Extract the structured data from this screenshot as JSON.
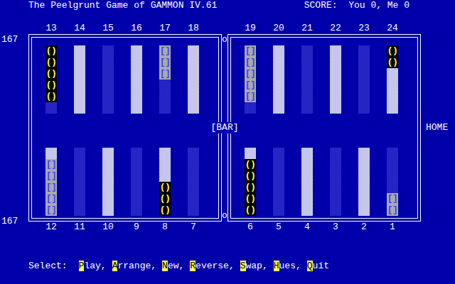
{
  "title": "The Peelgrunt Game of GAMMON IV.61",
  "score": "SCORE:  You 0, Me 0",
  "pip_counts": [
    "167",
    "167"
  ],
  "bar": {
    "label": "[BAR]",
    "marks": [
      "o",
      "o"
    ]
  },
  "home": "HOME",
  "board": {
    "top_left": [
      {
        "label": "13",
        "shade": "dark",
        "checkers": [
          {
            "glyph": "()",
            "kind": "round",
            "color": "#ffff55"
          },
          {
            "glyph": "()",
            "kind": "round",
            "color": "#ffff55"
          },
          {
            "glyph": "()",
            "kind": "round",
            "color": "#ffff55"
          },
          {
            "glyph": "()",
            "kind": "round",
            "color": "#ffff55"
          },
          {
            "glyph": "()",
            "kind": "round",
            "color": "#ffff55"
          }
        ]
      },
      {
        "label": "14",
        "shade": "light",
        "checkers": []
      },
      {
        "label": "15",
        "shade": "dark",
        "checkers": []
      },
      {
        "label": "16",
        "shade": "light",
        "checkers": []
      },
      {
        "label": "17",
        "shade": "dark",
        "checkers": [
          {
            "glyph": "[]",
            "kind": "square",
            "color": "#aaaaaa"
          },
          {
            "glyph": "[]",
            "kind": "square",
            "color": "#aaaaaa"
          },
          {
            "glyph": "[]",
            "kind": "square",
            "color": "#aaaaaa"
          }
        ]
      },
      {
        "label": "18",
        "shade": "light",
        "checkers": []
      }
    ],
    "top_right": [
      {
        "label": "19",
        "shade": "dark",
        "checkers": [
          {
            "glyph": "[]",
            "kind": "square",
            "color": "#aaaaaa"
          },
          {
            "glyph": "[]",
            "kind": "square",
            "color": "#aaaaaa"
          },
          {
            "glyph": "[]",
            "kind": "square",
            "color": "#aaaaaa"
          },
          {
            "glyph": "[]",
            "kind": "square",
            "color": "#aaaaaa"
          },
          {
            "glyph": "[]",
            "kind": "square",
            "color": "#aaaaaa"
          }
        ]
      },
      {
        "label": "20",
        "shade": "light",
        "checkers": []
      },
      {
        "label": "21",
        "shade": "dark",
        "checkers": []
      },
      {
        "label": "22",
        "shade": "light",
        "checkers": []
      },
      {
        "label": "23",
        "shade": "dark",
        "checkers": []
      },
      {
        "label": "24",
        "shade": "light",
        "checkers": [
          {
            "glyph": "()",
            "kind": "round",
            "color": "#ffff55"
          },
          {
            "glyph": "()",
            "kind": "round",
            "color": "#ffff55"
          }
        ]
      }
    ],
    "bottom_left": [
      {
        "label": "12",
        "shade": "light",
        "checkers": [
          {
            "glyph": "[]",
            "kind": "square",
            "color": "#aaaaaa"
          },
          {
            "glyph": "[]",
            "kind": "square",
            "color": "#aaaaaa"
          },
          {
            "glyph": "[]",
            "kind": "square",
            "color": "#aaaaaa"
          },
          {
            "glyph": "[]",
            "kind": "square",
            "color": "#aaaaaa"
          },
          {
            "glyph": "[]",
            "kind": "square",
            "color": "#aaaaaa"
          }
        ]
      },
      {
        "label": "11",
        "shade": "dark",
        "checkers": []
      },
      {
        "label": "10",
        "shade": "light",
        "checkers": []
      },
      {
        "label": "9",
        "shade": "dark",
        "checkers": []
      },
      {
        "label": "8",
        "shade": "light",
        "checkers": [
          {
            "glyph": "()",
            "kind": "round",
            "color": "#ffff55"
          },
          {
            "glyph": "()",
            "kind": "round",
            "color": "#ffff55"
          },
          {
            "glyph": "()",
            "kind": "round",
            "color": "#ffff55"
          }
        ]
      },
      {
        "label": "7",
        "shade": "dark",
        "checkers": []
      }
    ],
    "bottom_right": [
      {
        "label": "6",
        "shade": "light",
        "checkers": [
          {
            "glyph": "()",
            "kind": "round",
            "color": "#ffff55"
          },
          {
            "glyph": "()",
            "kind": "round",
            "color": "#ffff55"
          },
          {
            "glyph": "()",
            "kind": "round",
            "color": "#ffff55"
          },
          {
            "glyph": "()",
            "kind": "round",
            "color": "#ffff55"
          },
          {
            "glyph": "()",
            "kind": "round",
            "color": "#ffff55"
          }
        ]
      },
      {
        "label": "5",
        "shade": "dark",
        "checkers": []
      },
      {
        "label": "4",
        "shade": "light",
        "checkers": []
      },
      {
        "label": "3",
        "shade": "dark",
        "checkers": []
      },
      {
        "label": "2",
        "shade": "light",
        "checkers": []
      },
      {
        "label": "1",
        "shade": "dark",
        "checkers": [
          {
            "glyph": "[]",
            "kind": "square",
            "color": "#aaaaaa"
          },
          {
            "glyph": "[]",
            "kind": "square",
            "color": "#aaaaaa"
          }
        ]
      }
    ]
  },
  "menu": {
    "label": "Select:",
    "items": [
      {
        "key": "P",
        "rest": "lay,"
      },
      {
        "key": "A",
        "rest": "rrange,"
      },
      {
        "key": "N",
        "rest": "ew,"
      },
      {
        "key": "R",
        "rest": "everse,"
      },
      {
        "key": "S",
        "rest": "wap,"
      },
      {
        "key": "H",
        "rest": "ues,"
      },
      {
        "key": "Q",
        "rest": "uit"
      }
    ]
  }
}
